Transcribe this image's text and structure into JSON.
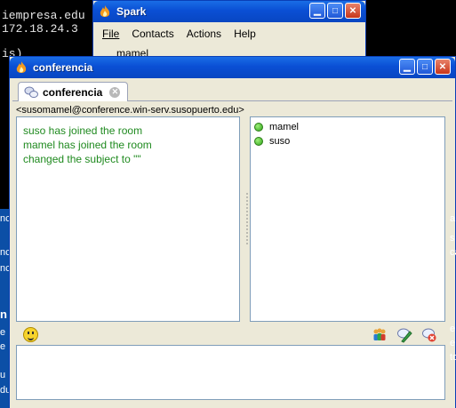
{
  "terminal": {
    "lines": [
      "iempresa.edu",
      "172.18.24.3",
      "is)"
    ]
  },
  "background_fragments": {
    "left": [
      "nc",
      "n",
      "e",
      "u",
      "du",
      "e",
      "nc",
      "nc"
    ],
    "right": [
      "a",
      "s",
      "ca",
      "e",
      "e",
      "to"
    ]
  },
  "spark_window": {
    "title": "Spark",
    "menu": [
      "File",
      "Contacts",
      "Actions",
      "Help"
    ],
    "user": "mamel"
  },
  "conference_window": {
    "title": "conferencia",
    "tab": {
      "label": "conferencia"
    },
    "room_address": "<susomamel@conference.win-serv.susopuerto.edu>",
    "messages": [
      "suso has joined the room",
      "mamel has joined the room",
      " changed the subject to \"\""
    ],
    "occupants": [
      "mamel",
      "suso"
    ],
    "message_color": "#1f8a1f"
  },
  "icons": {
    "app": "spark-flame-icon",
    "tab": "chat-bubbles-icon",
    "emoticon": "smiley-icon",
    "invite": "group-users-icon",
    "subject": "edit-subject-icon",
    "leave": "leave-room-icon"
  },
  "colors": {
    "titlebar": "#0a4fd4",
    "desktop": "#0c4fa6",
    "window_face": "#ece9d8",
    "occupant_online": "#2fa31a"
  }
}
